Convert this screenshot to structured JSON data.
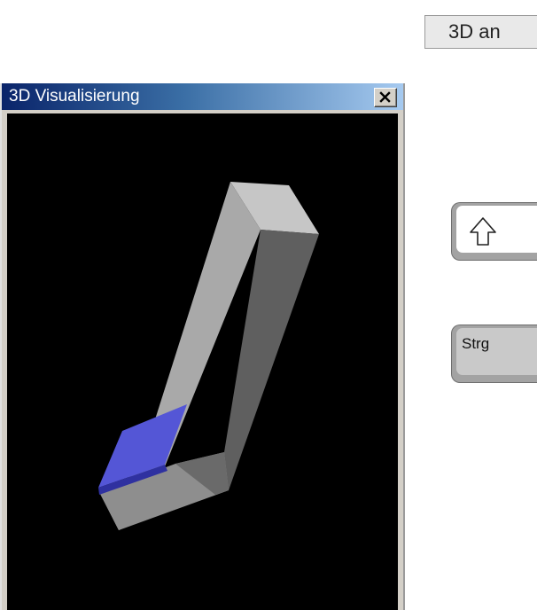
{
  "softkey": {
    "label": "3D an"
  },
  "window": {
    "title": "3D Visualisierung",
    "close_icon": "close-x-icon"
  },
  "scene": {
    "description_icon": "tool-holder-with-insert",
    "colors": {
      "background": "#000000",
      "shank_front": "#a8a8a8",
      "shank_side": "#5e5e5e",
      "shank_top": "#c4c4c4",
      "insert": "#5456d6",
      "insert_edge": "#2f31a0"
    }
  },
  "keys": {
    "shift": {
      "icon": "shift-arrow-icon"
    },
    "strg": {
      "label": "Strg"
    }
  }
}
